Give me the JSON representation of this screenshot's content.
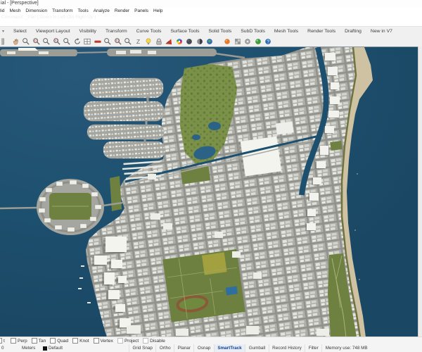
{
  "window": {
    "title": "ial - [Perspective]"
  },
  "menu": {
    "items": [
      "lid",
      "Mesh",
      "Dimension",
      "Transform",
      "Tools",
      "Analyze",
      "Render",
      "Panels",
      "Help"
    ]
  },
  "command": {
    "line1": "Command: _Pan ( Down  In  Left  Out  Right  Up )"
  },
  "tabs": {
    "items": [
      "Select",
      "Viewport Layout",
      "Visibility",
      "Transform",
      "Curve Tools",
      "Surface Tools",
      "Solid Tools",
      "SubD Tools",
      "Mesh Tools",
      "Render Tools",
      "Drafting",
      "New in V7"
    ]
  },
  "toolbar": {
    "icons": [
      {
        "name": "toolbar-partial-icon",
        "type": "partial"
      },
      {
        "name": "pan-hand-icon",
        "type": "hand"
      },
      {
        "name": "zoom-dynamic-icon",
        "type": "mag"
      },
      {
        "name": "zoom-window-icon",
        "type": "magd"
      },
      {
        "name": "zoom-extents-icon",
        "type": "mag"
      },
      {
        "name": "zoom-selected-icon",
        "type": "magd"
      },
      {
        "name": "zoom-target-icon",
        "type": "mag"
      },
      {
        "name": "rotate-view-icon",
        "type": "rot"
      },
      {
        "name": "viewport-layout-icon",
        "type": "grid"
      },
      {
        "name": "undo-view-icon",
        "type": "redbar"
      },
      {
        "name": "pan-view-icon",
        "type": "mag"
      },
      {
        "name": "zoom-in-icon",
        "type": "magd"
      },
      {
        "name": "zoom-out-icon",
        "type": "mag"
      },
      {
        "name": "named-views-icon",
        "type": "zchar"
      },
      {
        "name": "lightbulb-icon",
        "type": "bulb"
      },
      {
        "name": "lock-icon",
        "type": "lock"
      },
      {
        "name": "spotlight-icon",
        "type": "fan"
      },
      {
        "name": "color-wheel-icon",
        "type": "wheel"
      },
      {
        "name": "globe-dark-icon",
        "type": "gdark"
      },
      {
        "name": "globe-shaded-icon",
        "type": "ghalf"
      },
      {
        "name": "globe-blue-icon",
        "type": "gblue"
      },
      {
        "name": "toolbar-gap",
        "type": "spacer"
      },
      {
        "name": "material-orange-icon",
        "type": "orange"
      },
      {
        "name": "texture-icon",
        "type": "tex"
      },
      {
        "name": "environment-icon",
        "type": "gear"
      },
      {
        "name": "earth-green-icon",
        "type": "ggreen"
      },
      {
        "name": "help-sphere-icon",
        "type": "help"
      }
    ]
  },
  "osnap": {
    "partial": "t",
    "items": [
      "Perp",
      "Tan",
      "Quad",
      "Knot",
      "Vertex",
      "Project",
      "Disable"
    ]
  },
  "status": {
    "coord": "0",
    "units": "Meters",
    "layer": "Default",
    "panes": [
      "Grid Snap",
      "Ortho",
      "Planar",
      "Osnap",
      "SmartTrack",
      "Gumball",
      "Record History",
      "Filter",
      "Memory use: 748 MB"
    ],
    "active_pane": "SmartTrack"
  },
  "colors": {
    "water": "#1d4f6e",
    "sand": "#cfc2a2",
    "park": "#6f8140",
    "building": "#efefe9",
    "smarttrack_active": "#0f3f8f"
  }
}
